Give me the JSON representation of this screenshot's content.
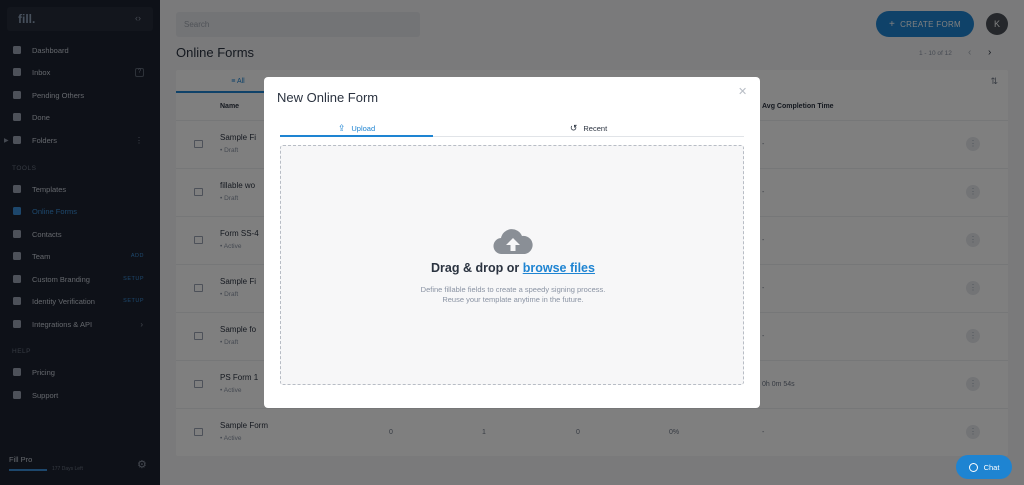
{
  "app": {
    "logo": "fill."
  },
  "sidebar": {
    "items": [
      {
        "label": "Dashboard"
      },
      {
        "label": "Inbox",
        "count": "?"
      },
      {
        "label": "Pending Others"
      },
      {
        "label": "Done"
      },
      {
        "label": "Folders"
      }
    ],
    "tools_title": "TOOLS",
    "tools": [
      {
        "label": "Templates"
      },
      {
        "label": "Online Forms"
      },
      {
        "label": "Contacts"
      },
      {
        "label": "Team",
        "badge": "ADD"
      },
      {
        "label": "Custom Branding",
        "badge": "SETUP"
      },
      {
        "label": "Identity Verification",
        "badge": "SETUP"
      },
      {
        "label": "Integrations & API"
      }
    ],
    "help_title": "HELP",
    "help": [
      {
        "label": "Pricing"
      },
      {
        "label": "Support"
      }
    ],
    "plan": "Fill Pro",
    "plan_days": "177 Days Left"
  },
  "header": {
    "search_placeholder": "Search",
    "create_button": "CREATE FORM",
    "avatar_initial": "K"
  },
  "main": {
    "title": "Online Forms",
    "pagination": "1 - 10 of 12",
    "tab_all": "All",
    "columns": {
      "name": "Name",
      "avg_time": "Avg Completion Time"
    },
    "rows": [
      {
        "name": "Sample Fi",
        "status": "Draft",
        "v1": "",
        "v2": "",
        "v3": "",
        "v4": "",
        "avg": "-"
      },
      {
        "name": "fillable wo",
        "status": "Draft",
        "v1": "",
        "v2": "",
        "v3": "",
        "v4": "",
        "avg": "-"
      },
      {
        "name": "Form SS-4",
        "status": "Active",
        "v1": "",
        "v2": "",
        "v3": "",
        "v4": "",
        "avg": "-"
      },
      {
        "name": "Sample Fi",
        "status": "Draft",
        "v1": "",
        "v2": "",
        "v3": "",
        "v4": "",
        "avg": "-"
      },
      {
        "name": "Sample fo",
        "status": "Draft",
        "v1": "",
        "v2": "",
        "v3": "",
        "v4": "",
        "avg": "-"
      },
      {
        "name": "PS Form 1",
        "status": "Active",
        "v1": "",
        "v2": "",
        "v3": "",
        "v4": "",
        "avg": "0h 0m 54s"
      },
      {
        "name": "Sample Form",
        "status": "Active",
        "v1": "0",
        "v2": "1",
        "v3": "0",
        "v4": "0%",
        "avg": "-"
      }
    ]
  },
  "modal": {
    "title": "New Online Form",
    "tab_upload": "Upload",
    "tab_recent": "Recent",
    "drag_text": "Drag & drop or",
    "browse_text": "browse files",
    "desc_line1": "Define fillable fields to create a speedy signing process.",
    "desc_line2": "Reuse your template anytime in the future."
  },
  "chat": {
    "label": "Chat"
  },
  "colors": {
    "accent": "#1e84d2",
    "sidebar_bg": "#1d2330"
  }
}
